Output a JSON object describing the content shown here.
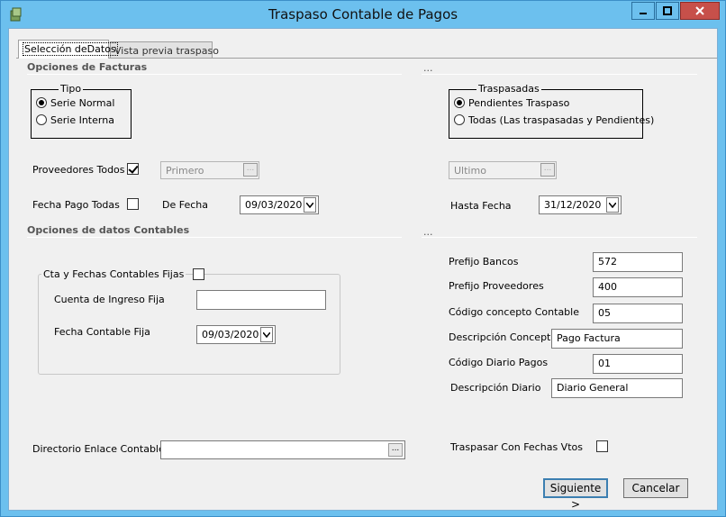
{
  "window": {
    "title": "Traspaso Contable de Pagos"
  },
  "tabs": [
    {
      "label": "Selección deDatos"
    },
    {
      "label": "Vista previa traspaso"
    }
  ],
  "opciones_facturas": {
    "title": "Opciones de Facturas",
    "right_title": "...",
    "tipo": {
      "legend": "Tipo",
      "options": [
        {
          "label": "Serie Normal",
          "selected": true
        },
        {
          "label": "Serie Interna",
          "selected": false
        }
      ]
    },
    "traspasadas": {
      "legend": "Traspasadas",
      "options": [
        {
          "label": "Pendientes Traspaso",
          "selected": true
        },
        {
          "label": "Todas (Las traspasadas y Pendientes)",
          "selected": false
        }
      ]
    },
    "proveedores_todos": {
      "label": "Proveedores Todos",
      "checked": true
    },
    "primero": {
      "value": "Primero",
      "button": "..."
    },
    "ultimo": {
      "value": "Ultimo",
      "button": "..."
    },
    "fecha_pago_todas": {
      "label": "Fecha Pago Todas",
      "checked": false
    },
    "de_fecha": {
      "label": "De Fecha",
      "value": "09/03/2020"
    },
    "hasta_fecha": {
      "label": "Hasta Fecha",
      "value": "31/12/2020"
    }
  },
  "opciones_contables": {
    "title": "Opciones de datos Contables",
    "right_title": "...",
    "fijas": {
      "label": "Cta y Fechas Contables Fijas",
      "checked": false,
      "cuenta_label": "Cuenta de Ingreso Fija",
      "cuenta_value": "",
      "fecha_label": "Fecha Contable Fija",
      "fecha_value": "09/03/2020"
    },
    "prefijo_bancos": {
      "label": "Prefijo Bancos",
      "value": "572"
    },
    "prefijo_proveedores": {
      "label": "Prefijo Proveedores",
      "value": "400"
    },
    "codigo_concepto": {
      "label": "Código concepto Contable",
      "value": "05"
    },
    "descripcion_concepto": {
      "label": "Descripción Concepto",
      "value": "Pago Factura"
    },
    "codigo_diario": {
      "label": "Código Diario Pagos",
      "value": "01"
    },
    "descripcion_diario": {
      "label": "Descripción Diario",
      "value": "Diario General"
    },
    "directorio": {
      "label": "Directorio Enlace Contable",
      "value": "",
      "button": "..."
    },
    "traspasar_fechas": {
      "label": "Traspasar Con Fechas Vtos",
      "checked": false
    }
  },
  "buttons": {
    "siguiente": "Siguiente >",
    "cancelar": "Cancelar"
  },
  "colors": {
    "titlebar": "#6cc0ee",
    "close": "#c7504a",
    "panel": "#f0f0f0"
  }
}
